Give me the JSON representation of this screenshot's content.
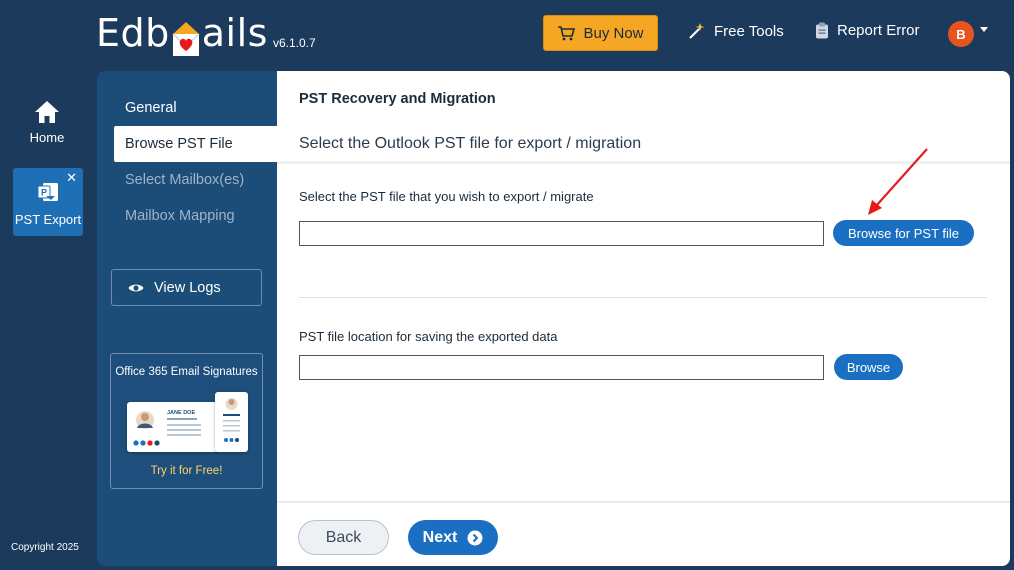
{
  "header": {
    "logo_left": "Edb",
    "logo_right": "ails",
    "version": "v6.1.0.7",
    "buy_now_label": "Buy Now",
    "free_tools_label": "Free Tools",
    "report_error_label": "Report Error",
    "avatar_initial": "B",
    "icons": [
      "cart-icon",
      "wand-icon",
      "clipboard-icon",
      "chevron-down-icon"
    ]
  },
  "rail": {
    "home_label": "Home",
    "pst_export_label": "PST Export",
    "close_glyph": "✕",
    "copyright": "Copyright 2025"
  },
  "steps": {
    "items": [
      {
        "label": "General",
        "state": "done"
      },
      {
        "label": "Browse PST File",
        "state": "active"
      },
      {
        "label": "Select Mailbox(es)",
        "state": "disabled"
      },
      {
        "label": "Mailbox Mapping",
        "state": "disabled"
      }
    ],
    "view_logs_label": "View Logs",
    "promo": {
      "title": "Office 365 Email Signatures",
      "link": "Try it for Free!",
      "card_name": "JANE DOE"
    }
  },
  "main": {
    "title": "PST Recovery and Migration",
    "subtitle": "Select the Outlook PST file for export / migration",
    "source_label": "Select the PST file that you wish to export / migrate",
    "source_value": "",
    "browse_pst_label": "Browse for PST file",
    "dest_label": "PST file location for saving the exported data",
    "dest_value": "",
    "browse_label": "Browse"
  },
  "footer": {
    "back_label": "Back",
    "next_label": "Next"
  },
  "colors": {
    "background": "#1b3a5c",
    "panel": "#1c4d78",
    "accent": "#1a6fc2",
    "buy_button": "#f5a623",
    "avatar": "#e8541e",
    "annotation_arrow": "#e8191b"
  }
}
